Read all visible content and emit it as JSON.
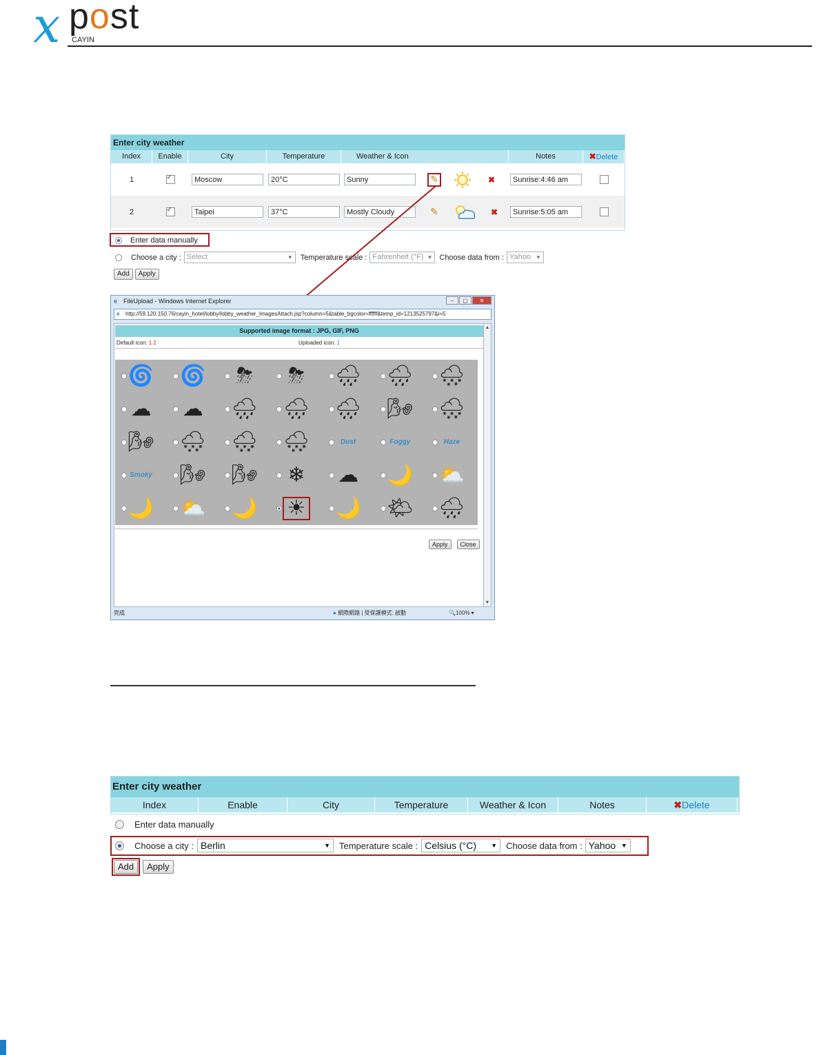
{
  "logo": {
    "x": "x",
    "post_p": "p",
    "post_o": "o",
    "post_st": "st",
    "cayin": "CAYIN"
  },
  "panel1": {
    "title": "Enter city weather",
    "headers": [
      "Index",
      "Enable",
      "City",
      "Temperature",
      "Weather & Icon",
      "Notes",
      "Delete"
    ],
    "rows": [
      {
        "index": "1",
        "city": "Moscow",
        "temperature": "20°C",
        "weather": "Sunny",
        "notes": "Sunrise:4:46 am",
        "enabled": true
      },
      {
        "index": "2",
        "city": "Taipei",
        "temperature": "37°C",
        "weather": "Mostly Cloudy",
        "notes": "Sunrise:5:05 am",
        "enabled": true
      }
    ],
    "manual_label": "Enter data manually",
    "choose_city_label": "Choose a city :",
    "city_select": "Select",
    "temp_scale_label": "Temperature scale :",
    "temp_scale_value": "Fahrenheit (°F)",
    "data_from_label": "Choose data from :",
    "data_from_value": "Yahoo",
    "add_label": "Add",
    "apply_label": "Apply"
  },
  "dialog": {
    "title": "FileUpload - Windows Internet Explorer",
    "url": "http://59.120.150.76/cayin_hotel/lobby/lobby_weather_ImagesAttach.jsp?column=5&table_bgcolor=ffffff&temp_id=1213525797&i=5",
    "format_text": "Supported image format : JPG, GIF, PNG",
    "default_icon_label": "Default icon:",
    "default_icon_pages": "1 2",
    "uploaded_icon_label": "Uploaded icon:",
    "uploaded_icon_pages": "1",
    "icons": [
      "🌀",
      "🌀",
      "⛈",
      "⛈",
      "🌧",
      "🌧",
      "🌨",
      "☁",
      "☁",
      "🌧",
      "🌧",
      "🌧",
      "🌬",
      "🌨",
      "🌬",
      "🌨",
      "🌨",
      "🌨",
      "Dust",
      "Foggy",
      "Haze",
      "Smoky",
      "🌬",
      "🌬",
      "❄",
      "☁",
      "🌙",
      "⛅",
      "🌙",
      "⛅",
      "🌙",
      "☀",
      "🌙",
      "🌤",
      "🌧"
    ],
    "apply_label": "Apply",
    "close_label": "Close",
    "status_left": "完成",
    "status_mid": "網際網路 | 受保護模式: 啟動",
    "status_zoom": "100%"
  },
  "panel2": {
    "title": "Enter city weather",
    "headers": [
      "Index",
      "Enable",
      "City",
      "Temperature",
      "Weather & Icon",
      "Notes",
      "Delete"
    ],
    "manual_label": "Enter data manually",
    "choose_city_label": "Choose a city :",
    "city_value": "Berlin",
    "temp_scale_label": "Temperature scale :",
    "temp_scale_value": "Celsius (°C)",
    "data_from_label": "Choose data from :",
    "data_from_value": "Yahoo",
    "add_label": "Add",
    "apply_label": "Apply"
  },
  "colors": {
    "accent": "#87d3e0",
    "header": "#b9e6ef",
    "highlight": "#a31c1c",
    "link": "#1e7fc8"
  }
}
